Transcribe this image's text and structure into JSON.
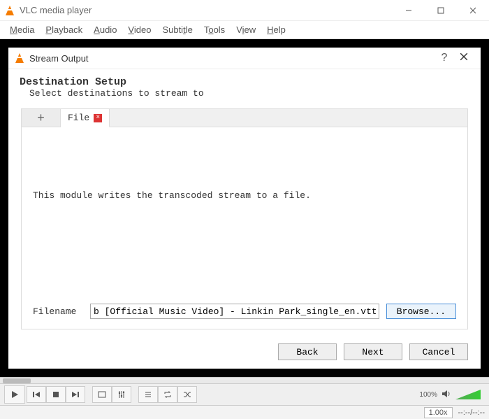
{
  "window": {
    "title": "VLC media player"
  },
  "menu": {
    "items": [
      "Media",
      "Playback",
      "Audio",
      "Video",
      "Subtitle",
      "Tools",
      "View",
      "Help"
    ]
  },
  "dialog": {
    "title": "Stream Output",
    "help": "?",
    "header_title": "Destination Setup",
    "header_sub": "Select destinations to stream to",
    "tab_add": "+",
    "tab_file_label": "File",
    "module_desc": "This module writes the transcoded stream to a file.",
    "filename_label": "Filename",
    "filename_value": "b [Official Music Video] - Linkin Park_single_en.vtt.ps",
    "browse_label": "Browse...",
    "back_label": "Back",
    "next_label": "Next",
    "cancel_label": "Cancel"
  },
  "status": {
    "volume_pct": "100%",
    "speed": "1.00x",
    "time": "--:--/--:--"
  }
}
